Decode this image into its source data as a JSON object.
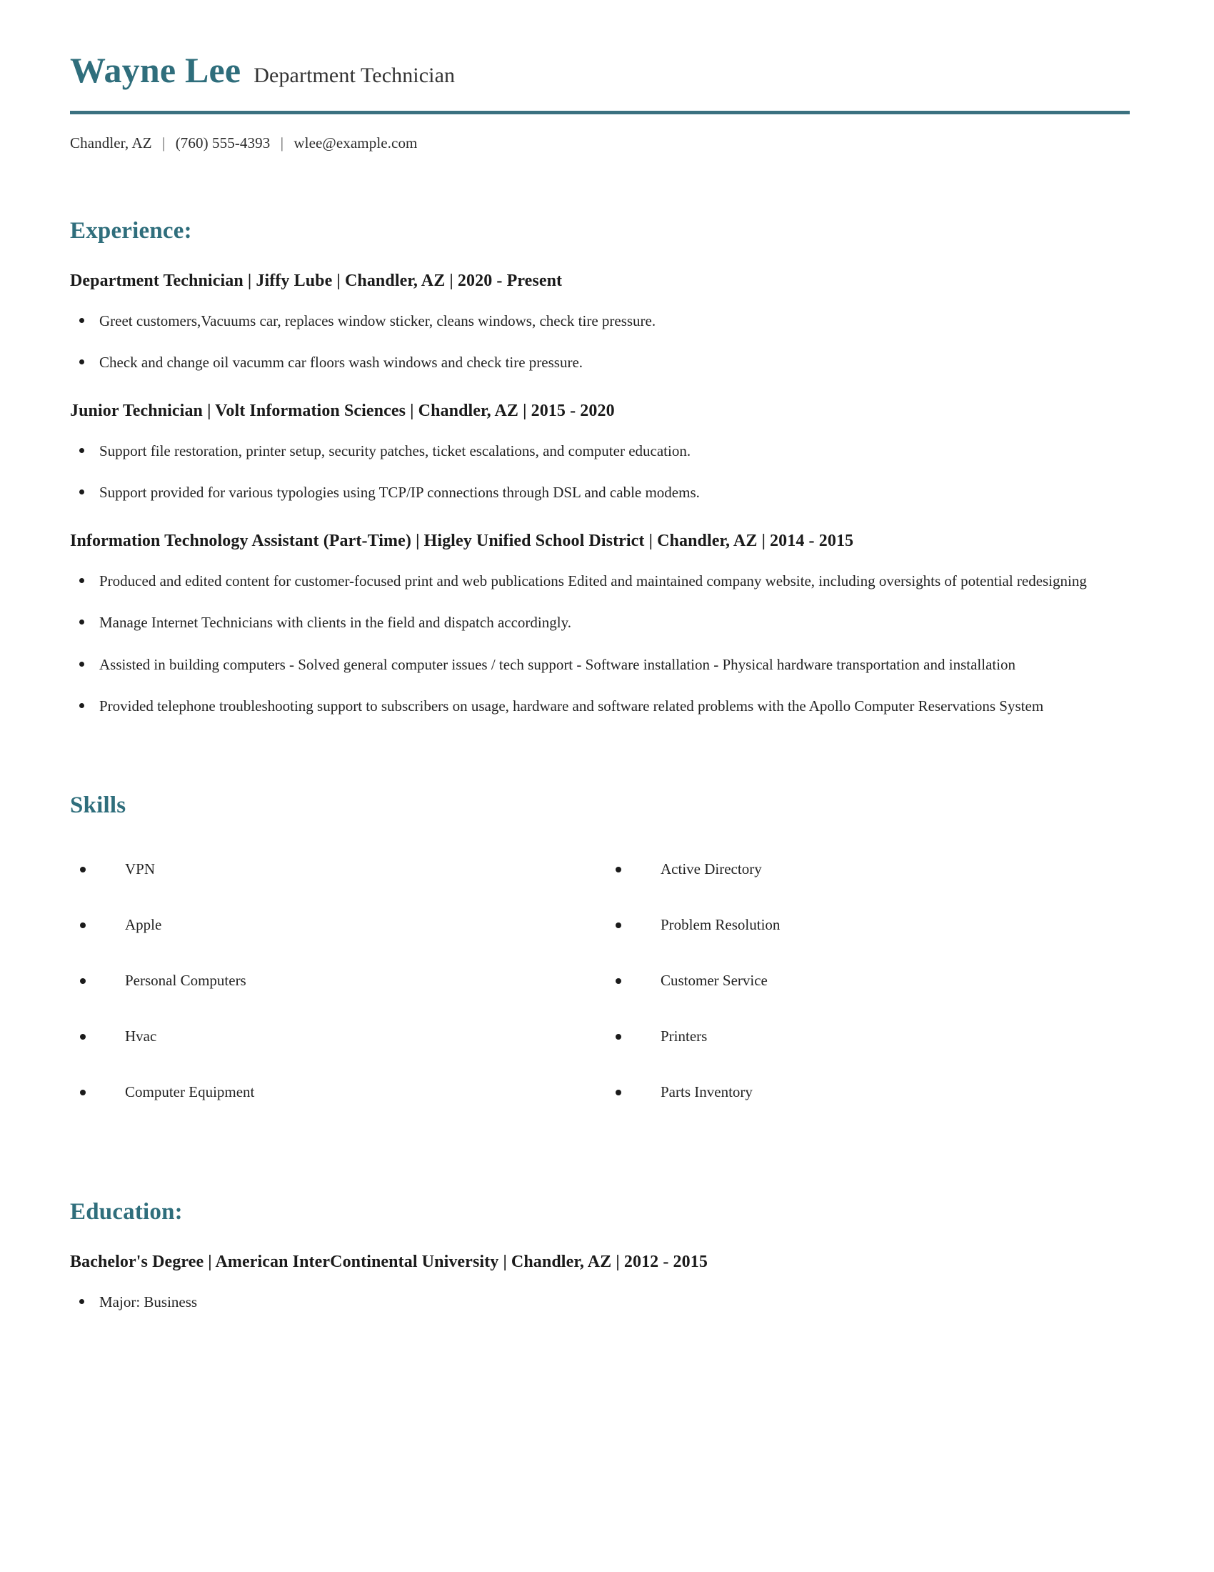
{
  "header": {
    "name": "Wayne Lee",
    "headline": "Department Technician",
    "accent_color": "#2f6e7c",
    "contact": {
      "location": "Chandler, AZ",
      "phone": "(760) 555-4393",
      "email": "wlee@example.com",
      "separator": "|"
    }
  },
  "experience": {
    "title": "Experience:",
    "entries": [
      {
        "heading": "Department Technician | Jiffy Lube | Chandler, AZ | 2020 - Present",
        "bullets": [
          "Greet customers,Vacuums car, replaces window sticker, cleans windows, check tire pressure.",
          "Check and change oil vacumm car floors wash windows and check tire pressure."
        ]
      },
      {
        "heading": "Junior Technician | Volt Information Sciences | Chandler, AZ | 2015 - 2020",
        "bullets": [
          "Support file restoration, printer setup, security patches, ticket escalations, and computer education.",
          "Support provided for various typologies using TCP/IP connections through DSL and cable modems."
        ]
      },
      {
        "heading": "Information Technology Assistant (Part-Time) | Higley Unified School District | Chandler, AZ | 2014 - 2015",
        "bullets": [
          "Produced and edited content for customer-focused print and web publications Edited and maintained company website, including oversights of potential redesigning",
          "Manage Internet Technicians with clients in the field and dispatch accordingly.",
          "Assisted in building computers - Solved general computer issues / tech support - Software installation - Physical hardware transportation and installation",
          "Provided telephone troubleshooting support to subscribers on usage, hardware and software related problems with the Apollo Computer Reservations System"
        ]
      }
    ]
  },
  "skills": {
    "title": "Skills",
    "left_column": [
      "VPN",
      "Apple",
      "Personal Computers",
      "Hvac",
      "Computer Equipment"
    ],
    "right_column": [
      "Active Directory",
      "Problem Resolution",
      "Customer Service",
      "Printers",
      "Parts Inventory"
    ]
  },
  "education": {
    "title": "Education:",
    "entries": [
      {
        "heading": "Bachelor's Degree | American InterContinental University | Chandler, AZ | 2012 - 2015",
        "bullets": [
          "Major: Business"
        ]
      }
    ]
  }
}
